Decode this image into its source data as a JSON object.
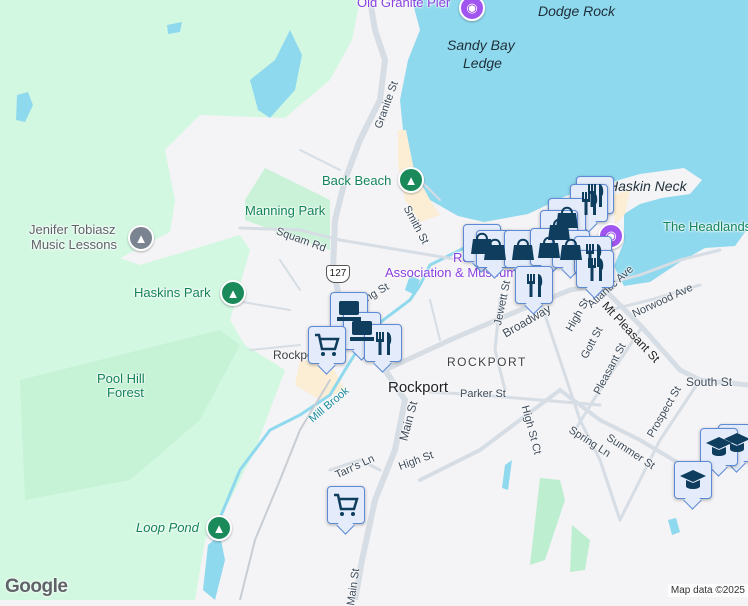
{
  "colors": {
    "land": "#f4f3f5",
    "park": "#d3f8e2",
    "water": "#8fd9ee",
    "road": "#d6dde4",
    "marker_bg": "#e4ecfb",
    "marker_border": "#5c8ad6",
    "marker_icon": "#0e3d5e"
  },
  "places": {
    "old_granite_pier": "Old Granite Pier",
    "dodge_rock": "Dodge Rock",
    "sandy_bay_ledge_1": "Sandy Bay",
    "sandy_bay_ledge_2": "Ledge",
    "back_beach": "Back Beach",
    "haskin_neck": "Haskin Neck",
    "the_headlands": "The Headlands",
    "manning_park": "Manning Park",
    "music_lessons_1": "Jenifer Tobiasz",
    "music_lessons_2": "Music Lessons",
    "haskins_park": "Haskins Park",
    "art_assoc_1": "Rockport Art",
    "art_assoc_2": "Association & Museum",
    "pool_hill_1": "Pool Hill",
    "pool_hill_2": "Forest",
    "loop_pond": "Loop Pond",
    "mill_brook": "Mill Brook",
    "district": "ROCKPORT",
    "town": "Rockport",
    "station": "Rockport"
  },
  "streets": {
    "granite": "Granite St",
    "smith": "Smith St",
    "squam": "Squam Rd",
    "king": "King St",
    "jewett": "Jewett St",
    "broadway": "Broadway",
    "high1": "High St",
    "atlantic": "Atlantic Ave",
    "norwood": "Norwood Ave",
    "mt_pleasant": "Mt Pleasant St",
    "gott": "Gott St",
    "pleasant": "Pleasant St",
    "parker": "Parker St",
    "south": "South St",
    "main1": "Main St",
    "main2": "Main St",
    "high_ct": "High St Ct",
    "prospect": "Prospect St",
    "spring": "Spring Ln",
    "summer": "Summer St",
    "high2": "High St",
    "tarrs": "Tarr's Ln"
  },
  "route_shield": "127",
  "footer": {
    "logo": "Google",
    "attribution": "Map data ©2025"
  }
}
